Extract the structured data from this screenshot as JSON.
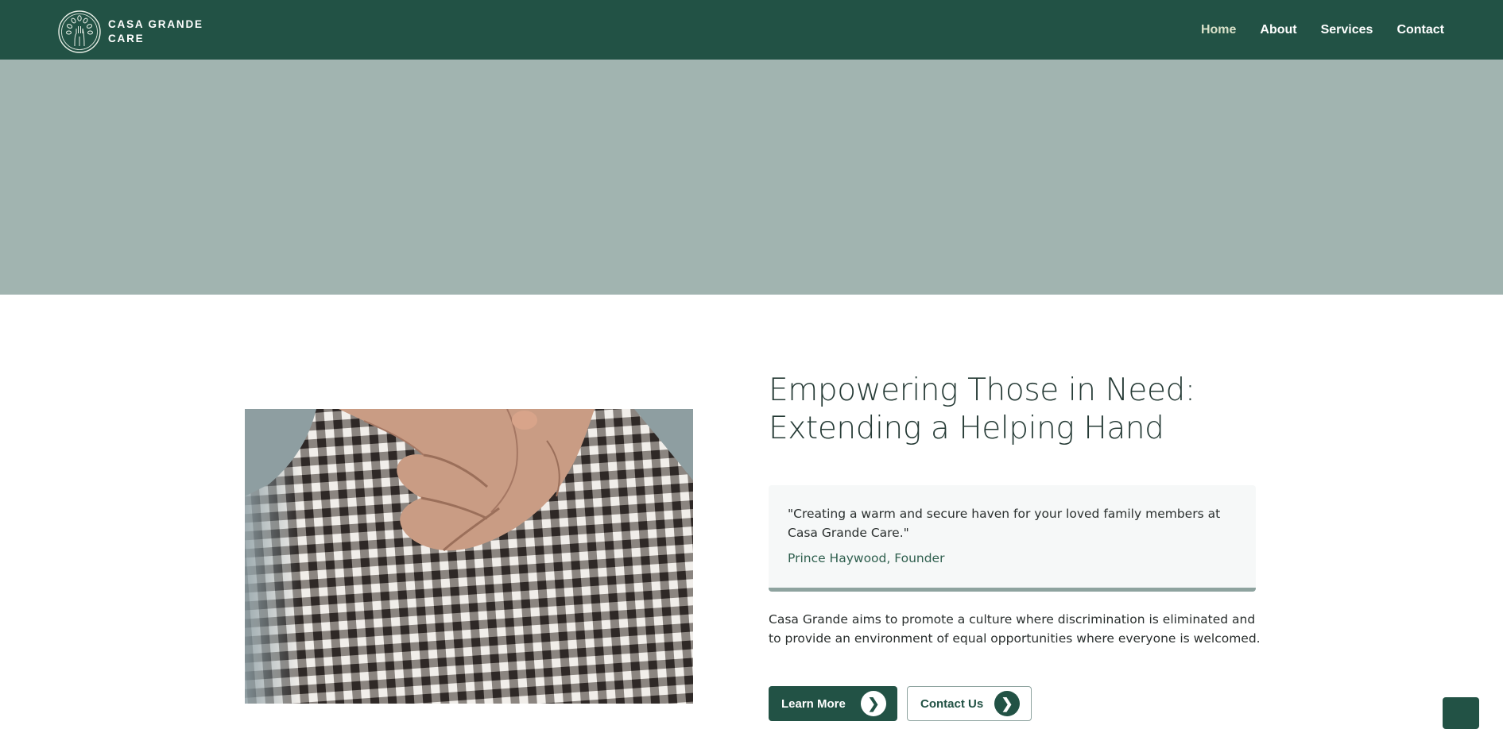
{
  "brand": {
    "line1": "Casa Grande",
    "line2": "Care",
    "logo_icon": "tree-hand-logo-icon"
  },
  "nav": {
    "items": [
      {
        "label": "Home",
        "active": true
      },
      {
        "label": "About",
        "active": false
      },
      {
        "label": "Services",
        "active": false
      },
      {
        "label": "Contact",
        "active": false
      }
    ]
  },
  "hero": {
    "band_color": "#a1b4b0"
  },
  "about": {
    "image_description_icon": "elderly-hands-photo",
    "headline_line1": "Empowering Those in Need:",
    "headline_line2": "Extending a Helping Hand",
    "quote": "\"Creating a warm and secure haven for your loved family members at Casa Grande Care.\"",
    "quote_author": "Prince Haywood, Founder",
    "paragraph": "Casa Grande aims to promote a culture where discrimination is eliminated and to provide an environment of equal opportunities where everyone is welcomed.",
    "primary_button": "Learn More",
    "secondary_button": "Contact Us",
    "button_icon": "chevron-right-icon"
  },
  "colors": {
    "primary": "#225245",
    "nav_active": "#d9e1c9",
    "accent_border": "#8ea39f",
    "hero_band": "#a1b4b0"
  },
  "back_to_top_icon": "arrow-up-icon"
}
